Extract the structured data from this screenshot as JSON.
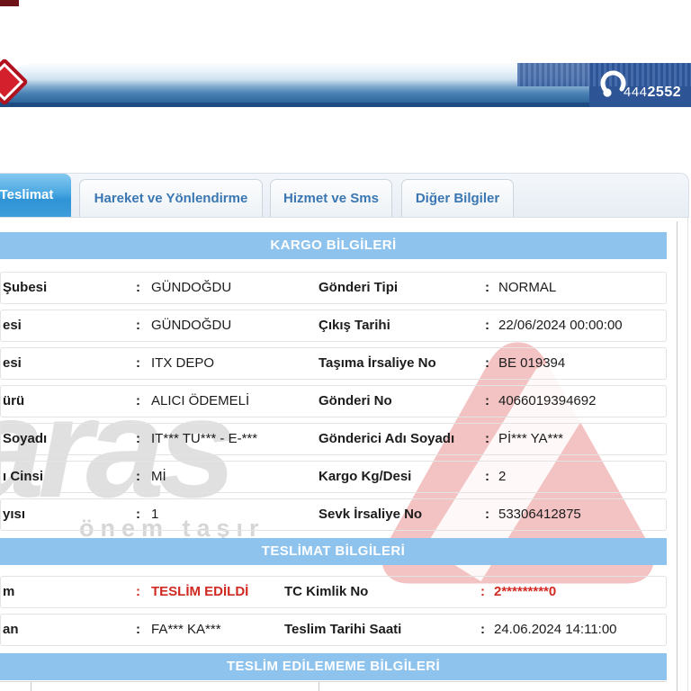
{
  "header": {
    "phone_prefix": "444",
    "phone_suffix": "2552"
  },
  "tabs": [
    {
      "label": "Teslimat",
      "active": true
    },
    {
      "label": "Hareket ve Yönlendirme",
      "active": false
    },
    {
      "label": "Hizmet ve Sms",
      "active": false
    },
    {
      "label": "Diğer Bilgiler",
      "active": false
    }
  ],
  "sections": {
    "kargo": {
      "title": "KARGO BİLGİLERİ",
      "rows": [
        {
          "l_label": "Şubesi",
          "l_value": "GÜNDOĞDU",
          "r_label": "Gönderi Tipi",
          "r_value": "NORMAL"
        },
        {
          "l_label": "esi",
          "l_value": "GÜNDOĞDU",
          "r_label": "Çıkış Tarihi",
          "r_value": "22/06/2024 00:00:00"
        },
        {
          "l_label": "esi",
          "l_value": "ITX DEPO",
          "r_label": "Taşıma İrsaliye No",
          "r_value": "BE 019394"
        },
        {
          "l_label": "ürü",
          "l_value": "ALICI ÖDEMELİ",
          "r_label": "Gönderi No",
          "r_value": "4066019394692"
        },
        {
          "l_label": "Soyadı",
          "l_value": "IT*** TU*** - E-***",
          "r_label": "Gönderici Adı Soyadı",
          "r_value": "Pİ*** YA***"
        },
        {
          "l_label": "ı Cinsi",
          "l_value": "Mİ",
          "r_label": "Kargo Kg/Desi",
          "r_value": "2"
        },
        {
          "l_label": "yısı",
          "l_value": "1",
          "r_label": "Sevk İrsaliye No",
          "r_value": "53306412875"
        }
      ]
    },
    "teslimat": {
      "title": "TESLİMAT BİLGİLERİ",
      "rows": [
        {
          "l_label": "m",
          "l_value": "TESLİM EDİLDİ",
          "r_label": "TC Kimlik No",
          "r_value": "2*********0"
        },
        {
          "l_label": "an",
          "l_value": "FA*** KA***",
          "r_label": "Teslim Tarihi Saati",
          "r_value": "24.06.2024 14:11:00"
        }
      ]
    },
    "teslim_edilememe": {
      "title": "TESLİM EDİLEMEME BİLGİLERİ"
    }
  },
  "watermark": {
    "brand": "aras",
    "slogan": "önem taşır"
  },
  "misc": {
    "colon": ":"
  },
  "colors": {
    "band_blue": "#8ec3ee",
    "active_tab_blue": "#2f93d6",
    "status_red": "#d02a22",
    "header_navy": "#2d5494",
    "logo_red": "#d41f2c"
  }
}
